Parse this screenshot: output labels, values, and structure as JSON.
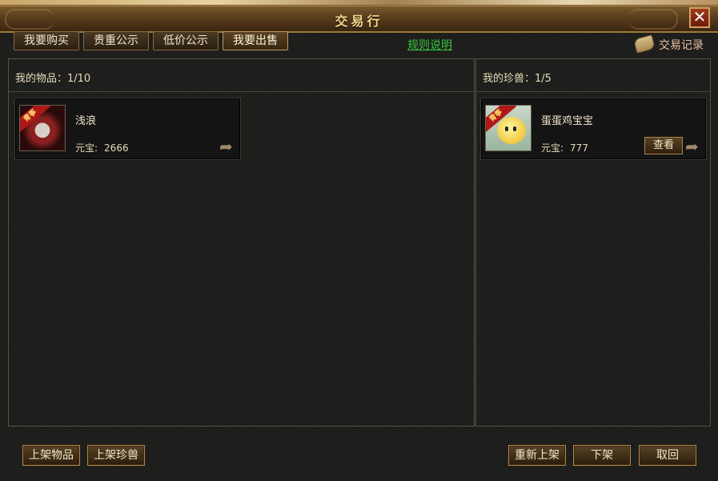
{
  "window": {
    "title": "交易行",
    "close_glyph": "✕"
  },
  "tabs": [
    {
      "label": "我要购买"
    },
    {
      "label": "贵重公示"
    },
    {
      "label": "低价公示"
    },
    {
      "label": "我要出售"
    }
  ],
  "rules_link": "规则说明",
  "record_link": "交易记录",
  "left_panel": {
    "header_label": "我的物品：1/10",
    "items": [
      {
        "name": "浅浪",
        "price_label": "元宝:",
        "price": "2666",
        "icon": "item-scroll-icon",
        "ribbon": "青筝"
      }
    ]
  },
  "right_panel": {
    "header_label": "我的珍兽：1/5",
    "items": [
      {
        "name": "蛋蛋鸡宝宝",
        "price_label": "元宝:",
        "price": "777",
        "icon": "chick-pet-icon",
        "ribbon": "青筝",
        "view_label": "查看"
      }
    ]
  },
  "bottom_buttons": {
    "list_item": "上架物品",
    "list_pet": "上架珍兽",
    "relist": "重新上架",
    "delist": "下架",
    "retrieve": "取回"
  },
  "colors": {
    "accent_gold": "#f4d88a",
    "link_green": "#36c43a",
    "record_pink": "#e8c0a0",
    "panel_bg": "#1d1d1c"
  }
}
